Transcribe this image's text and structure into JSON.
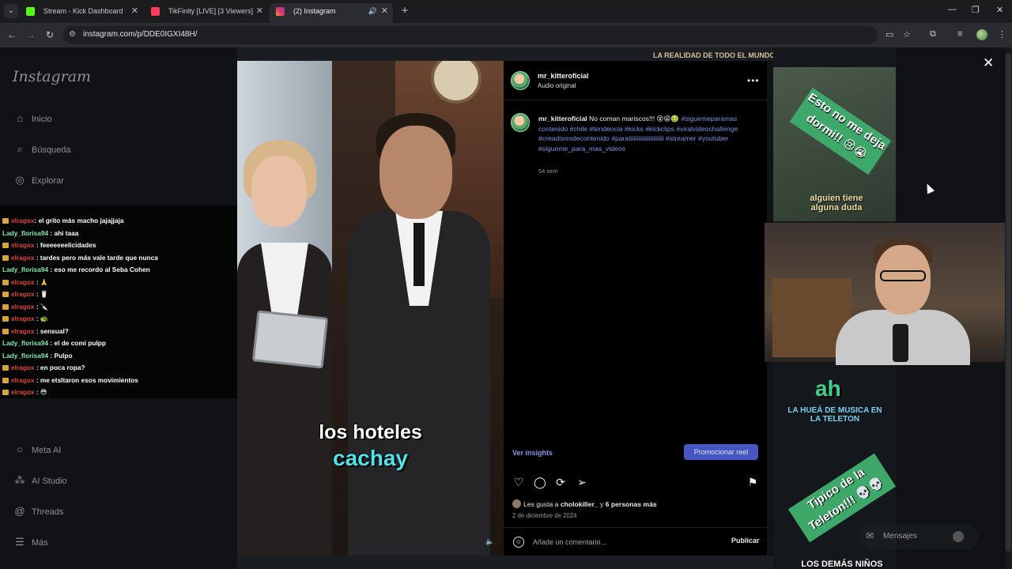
{
  "browser": {
    "tabs": [
      {
        "title": "Stream - Kick Dashboard",
        "favicon_color": "#53fc18"
      },
      {
        "title": "TikFinity [LIVE] [3 Viewers]",
        "favicon_color": "#ff3b5c"
      },
      {
        "title": "(2) Instagram",
        "favicon_color": "#e1306c"
      }
    ],
    "url": "instagram.com/p/DDE0IGXI48H/"
  },
  "sidebar": {
    "logo": "Instagram",
    "items": [
      {
        "label": "Inicio",
        "icon": "home-icon"
      },
      {
        "label": "Búsqueda",
        "icon": "search-icon"
      },
      {
        "label": "Explorar",
        "icon": "compass-icon"
      },
      {
        "label": "Meta AI",
        "icon": "meta-ai-icon"
      },
      {
        "label": "AI Studio",
        "icon": "ai-studio-icon"
      },
      {
        "label": "Threads",
        "icon": "threads-icon"
      },
      {
        "label": "Más",
        "icon": "menu-icon"
      }
    ]
  },
  "chat": [
    {
      "user": "elragox",
      "color": "red",
      "text": ": el grito más macho jajajjaja"
    },
    {
      "user": "Lady_florisa94",
      "color": "green",
      "text": " : ahi taaa"
    },
    {
      "user": "elragox",
      "color": "red",
      "text": " : feeeeeeelicidades"
    },
    {
      "user": "elragox",
      "color": "red",
      "text": " : tardes pero más vale tarde que nunca"
    },
    {
      "user": "Lady_florisa94",
      "color": "green",
      "text": " : eso me recordo al Seba Cohen"
    },
    {
      "user": "elragox",
      "color": "red",
      "text": " : 🙏"
    },
    {
      "user": "elragox",
      "color": "red",
      "text": " : 🥛"
    },
    {
      "user": "elragox",
      "color": "red",
      "text": " : 🔪"
    },
    {
      "user": "elragox",
      "color": "red",
      "text": " : 🐢"
    },
    {
      "user": "elragox",
      "color": "red",
      "text": " : sensual?"
    },
    {
      "user": "Lady_florisa94",
      "color": "green",
      "text": " : el de comi pulpp"
    },
    {
      "user": "Lady_florisa94",
      "color": "green",
      "text": " : Pulpo"
    },
    {
      "user": "elragox",
      "color": "red",
      "text": " : en poca ropa?"
    },
    {
      "user": "elragox",
      "color": "red",
      "text": " : me etsltaron esos movimientos"
    },
    {
      "user": "elragox",
      "color": "red",
      "text": " : 😳"
    }
  ],
  "reel": {
    "caption_line1": "los hoteles",
    "caption_line2": "cachay"
  },
  "post": {
    "username": "mr_kitteroficial",
    "audio": "Audio original",
    "caption_text": "No coman mariscos!!! 😵😫🤢",
    "hashtags": "#sigueme​paramas​contenido #chile #tendencia #kicks #kickclips #viralvideochallenge #creadoresdecontenido #paratiiiiiiiiiiiiiiiiiiiiii #streamer #youtuber #sigueme_para_mas_videos",
    "time_ago": "54 sem",
    "insights": "Ver insights",
    "promote": "Promocionar reel",
    "likes_prefix": "Les gusta a ",
    "likes_user": "cholokiller_",
    "likes_suffix": " y ",
    "likes_count": "6 personas más",
    "date": "2 de diciembre de 2024",
    "comment_placeholder": "Añade un comentario...",
    "publish": "Publicar"
  },
  "stream_overlay": {
    "top_banner": "LA REALIDAD DE TODO EL MUNDO",
    "sticker1": "Esto no me deja dormi!! 😢😭",
    "label1": "alguien tiene alguna duda",
    "ah": "ah",
    "label2": "LA HUEÁ DE MUSICA EN LA TELETON",
    "sticker2": "Tipico de la Teleton!!! 💀💀",
    "label3": "LOS DEMÁS NIÑOS",
    "messages": "Mensajes"
  }
}
